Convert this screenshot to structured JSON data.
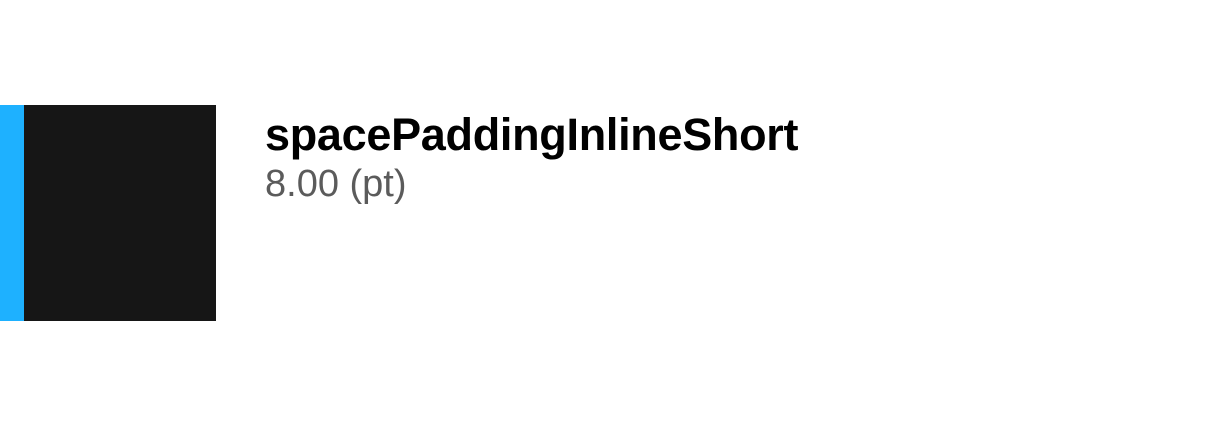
{
  "token": {
    "name": "spacePaddingInlineShort",
    "value": "8.00 (pt)"
  },
  "colors": {
    "swatch": "#161616",
    "padding_indicator": "#1eb1ff",
    "name_text": "#000000",
    "value_text": "#5b5b5b",
    "background": "#ffffff"
  }
}
